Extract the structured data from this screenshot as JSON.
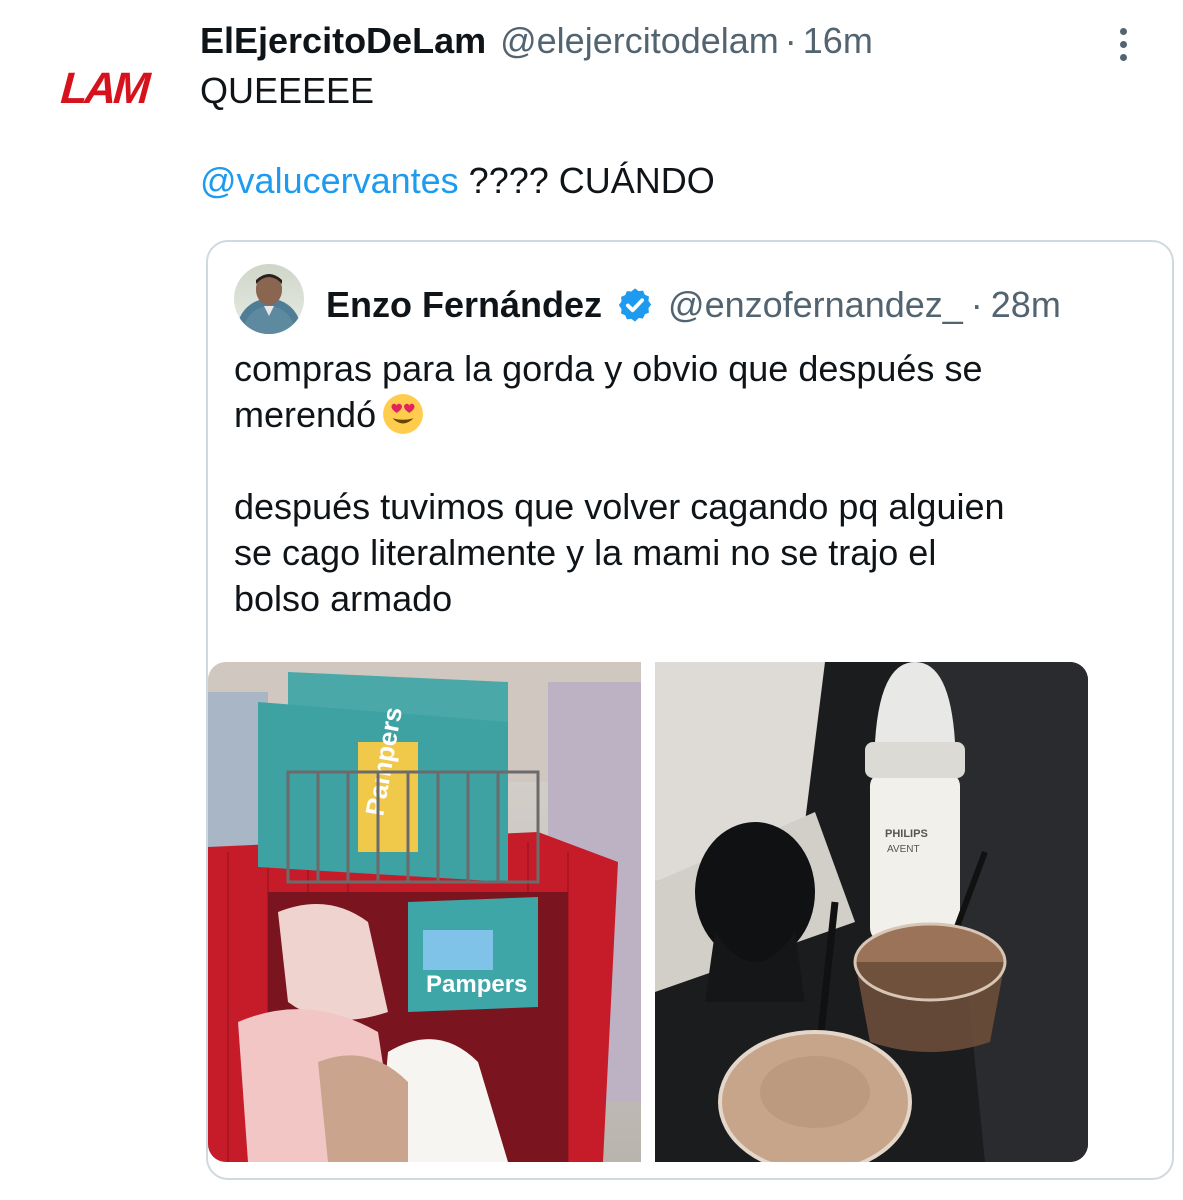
{
  "author": {
    "logo_text": "LAM",
    "name": "ElEjercitoDeLam",
    "handle": "@elejercitodelam",
    "separator": "·",
    "time": "16m"
  },
  "tweet": {
    "line1": "QUEEEEE",
    "mention": "@valucervantes",
    "line2_rest": " ???? CUÁNDO"
  },
  "quoted": {
    "name": "Enzo Fernández",
    "handle": "@enzofernandez_",
    "separator": "·",
    "time": "28m",
    "para1_line1": "compras para la gorda y obvio que después se",
    "para1_line2": "merendó",
    "para2_line1": "después tuvimos que volver cagando pq alguien",
    "para2_line2": "se cago literalmente y la mami no se trajo el",
    "para2_line3": "bolso armado",
    "emoji": "heart-eyes-emoji",
    "photo1_brand": "Pampers",
    "photo2_brand": "PHILIPS",
    "photo2_sub": "AVENT"
  },
  "colors": {
    "accent": "#1d9bf0",
    "logo": "#d6121c",
    "secondary_text": "#536471",
    "border": "#cfd9de"
  }
}
